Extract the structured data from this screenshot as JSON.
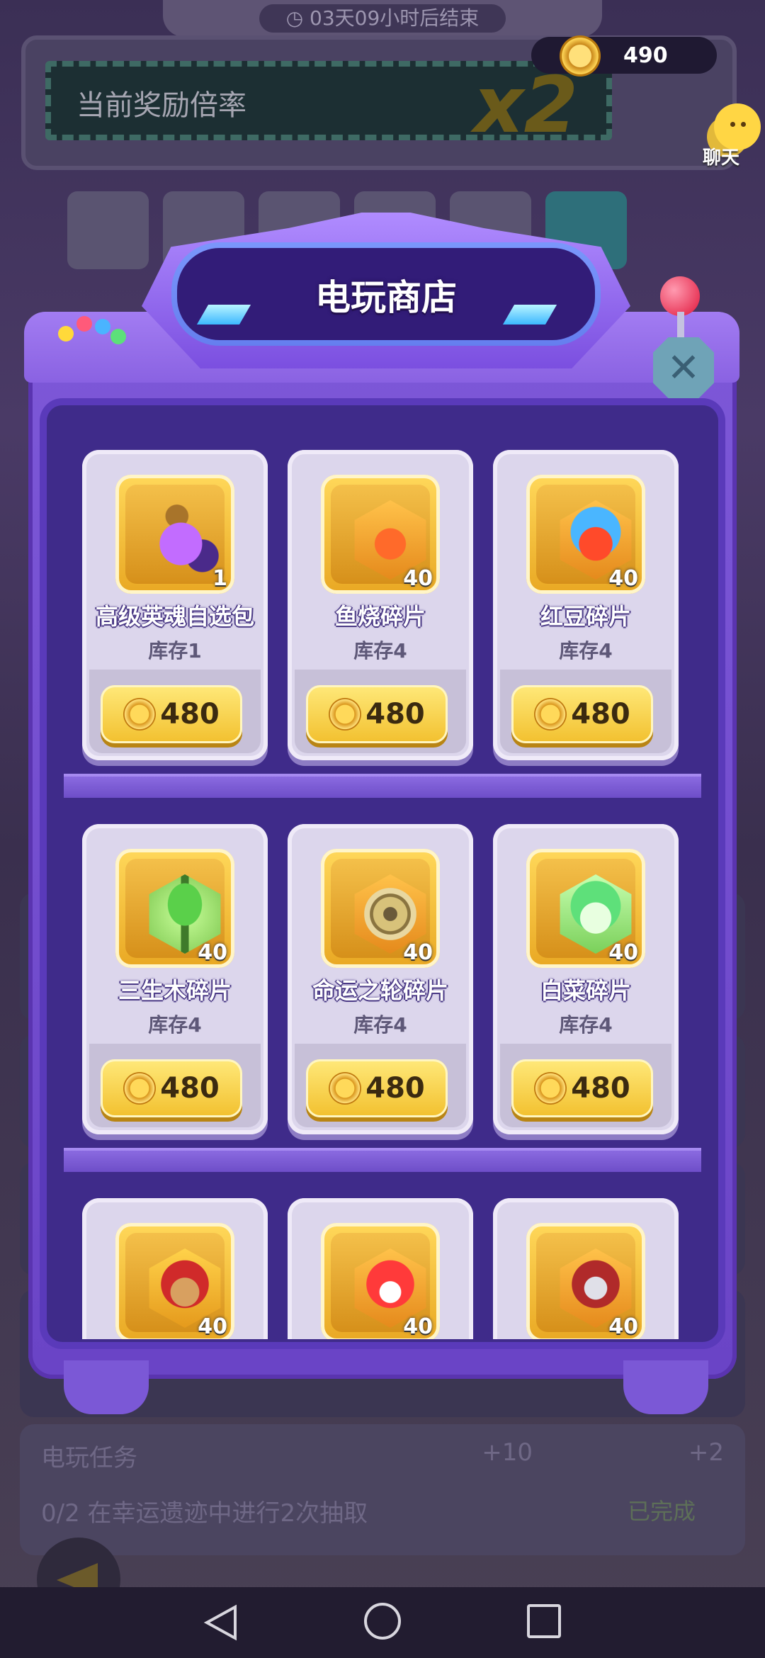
{
  "background": {
    "countdown": "03天09小时后结束",
    "coins": "490",
    "rate_label": "当前奖励倍率",
    "rate_value": "x2",
    "chat_label": "聊天",
    "task": {
      "title": "电玩任务",
      "reward1": "+10",
      "reward2": "+2",
      "progress": "0/2",
      "desc": "在幸运遗迹中进行2次抽取",
      "status": "已完成"
    }
  },
  "shop": {
    "title": "电玩商店",
    "rows": [
      [
        {
          "name": "高级英魂自选包",
          "count": "1",
          "stock": "库存1",
          "price": "480",
          "art": "bag"
        },
        {
          "name": "鱼烧碎片",
          "count": "40",
          "stock": "库存4",
          "price": "480",
          "art": "fish"
        },
        {
          "name": "红豆碎片",
          "count": "40",
          "stock": "库存4",
          "price": "480",
          "art": "bean"
        }
      ],
      [
        {
          "name": "三生木碎片",
          "count": "40",
          "stock": "库存4",
          "price": "480",
          "art": "tree"
        },
        {
          "name": "命运之轮碎片",
          "count": "40",
          "stock": "库存4",
          "price": "480",
          "art": "wheel"
        },
        {
          "name": "白菜碎片",
          "count": "40",
          "stock": "库存4",
          "price": "480",
          "art": "cabbage"
        }
      ],
      [
        {
          "count": "40",
          "art": "monkey"
        },
        {
          "count": "40",
          "art": "lion"
        },
        {
          "count": "40",
          "art": "armor"
        }
      ]
    ]
  },
  "colors": {
    "accent": "#7d58d8",
    "gold": "#f2c02e"
  }
}
